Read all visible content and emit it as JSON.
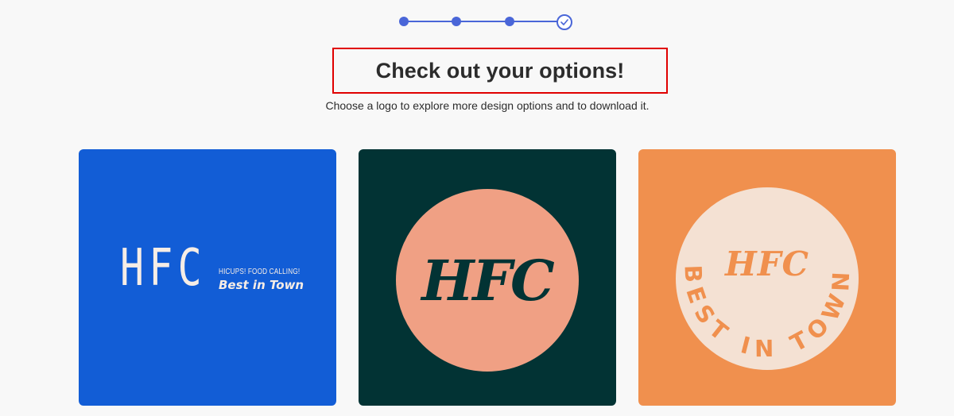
{
  "stepper": {
    "steps": 4,
    "current_step": 4,
    "accent_color": "#4a66d8"
  },
  "header": {
    "title": "Check out your options!",
    "subtitle": "Choose a logo to explore more design options and to download it."
  },
  "logos": [
    {
      "background": "#125dd6",
      "mark": "HFC",
      "tagline": "HICUPS! FOOD CALLING!",
      "slogan": "Best in Town"
    },
    {
      "background": "#023334",
      "circle_color": "#f0a084",
      "mark": "HFC"
    },
    {
      "background": "#f0904e",
      "circle_color": "#f4e1d3",
      "mark": "HFC",
      "arc_text": "BEST IN TOWN"
    }
  ]
}
